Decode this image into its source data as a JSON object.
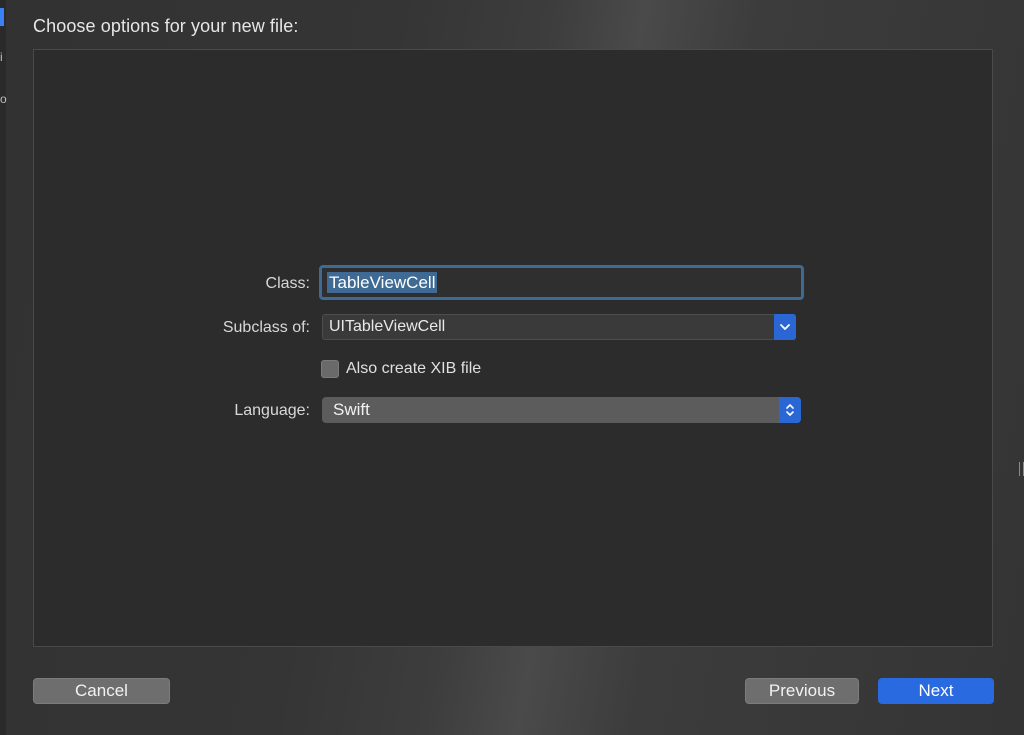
{
  "sheet": {
    "title": "Choose options for your new file:"
  },
  "form": {
    "class": {
      "label": "Class:",
      "value": "TableViewCell"
    },
    "subclass": {
      "label": "Subclass of:",
      "value": "UITableViewCell",
      "icon": "chevron-down-icon"
    },
    "xib": {
      "label": "Also create XIB file",
      "checked": false
    },
    "language": {
      "label": "Language:",
      "value": "Swift",
      "icon": "up-down-chevron-icon"
    }
  },
  "footer": {
    "cancel_label": "Cancel",
    "previous_label": "Previous",
    "next_label": "Next"
  },
  "colors": {
    "accent": "#2a6ae0",
    "focus_ring": "#3e6a94",
    "panel_bg": "#2c2c2d"
  }
}
